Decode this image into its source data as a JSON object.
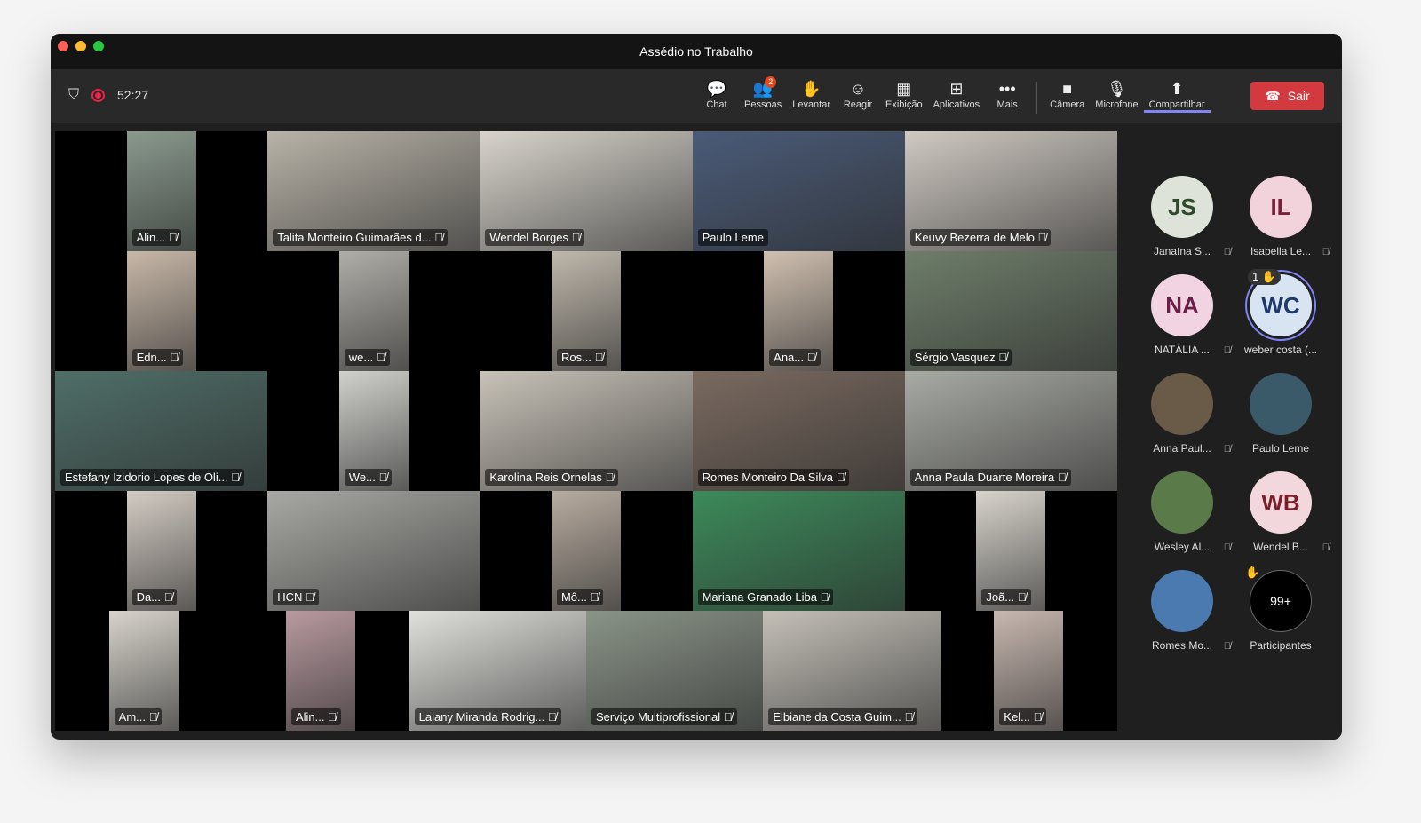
{
  "window": {
    "title": "Assédio no Trabalho"
  },
  "meeting": {
    "timer": "52:27"
  },
  "toolbar": [
    {
      "label": "Chat",
      "icon": "chat-icon",
      "glyph": "💬"
    },
    {
      "label": "Pessoas",
      "icon": "people-icon",
      "glyph": "👥",
      "badge": "2"
    },
    {
      "label": "Levantar",
      "icon": "raise-hand-icon",
      "glyph": "✋"
    },
    {
      "label": "Reagir",
      "icon": "smiley-icon",
      "glyph": "☺"
    },
    {
      "label": "Exibição",
      "icon": "grid-icon",
      "glyph": "▦"
    },
    {
      "label": "Aplicativos",
      "icon": "add-app-icon",
      "glyph": "⊞"
    },
    {
      "label": "Mais",
      "icon": "more-icon",
      "glyph": "•••"
    }
  ],
  "devices": [
    {
      "label": "Câmera",
      "icon": "camera-icon",
      "glyph": "■"
    },
    {
      "label": "Microfone",
      "icon": "mic-off-icon",
      "glyph": "🎙"
    },
    {
      "label": "Compartilhar",
      "icon": "share-icon",
      "glyph": "⬆"
    }
  ],
  "leave": {
    "label": "Sair"
  },
  "grid": [
    [
      {
        "n": "Alin...",
        "narrow": true,
        "c": "#8a9a8e"
      },
      {
        "n": "Talita Monteiro Guimarães d...",
        "c": "#b8b3a8"
      },
      {
        "n": "Wendel Borges",
        "c": "#d8d4cc"
      },
      {
        "n": "Paulo Leme",
        "c": "#4a5b78",
        "nomute": true
      },
      {
        "n": "Keuvy Bezerra de Melo",
        "c": "#cfc9c2"
      }
    ],
    [
      {
        "n": "Edn...",
        "narrow": true,
        "c": "#c8b8a8"
      },
      {
        "n": "we...",
        "narrow": true,
        "c": "#b0aea8"
      },
      {
        "n": "Ros...",
        "narrow": true,
        "c": "#c0b8ac"
      },
      {
        "n": "Ana...",
        "narrow": true,
        "c": "#d0c0b0"
      },
      {
        "n": "Sérgio Vasquez",
        "c": "#6e7d6a"
      }
    ],
    [
      {
        "n": "Estefany Izidorio Lopes de Oli...",
        "c": "#4f6e68"
      },
      {
        "n": "We...",
        "narrow": true,
        "c": "#d0d0cc"
      },
      {
        "n": "Karolina Reis Ornelas",
        "c": "#c8c2b8"
      },
      {
        "n": "Romes Monteiro Da Silva",
        "c": "#7a6a60"
      },
      {
        "n": "Anna Paula Duarte Moreira",
        "c": "#a8aaa4"
      }
    ],
    [
      {
        "n": "Da...",
        "narrow": true,
        "c": "#d4ccc4"
      },
      {
        "n": "HCN",
        "c": "#a8a8a4"
      },
      {
        "n": "Mô...",
        "narrow": true,
        "c": "#b8aca0"
      },
      {
        "n": "Mariana Granado Liba",
        "c": "#3c8a5a"
      },
      {
        "n": "Joã...",
        "narrow": true,
        "c": "#d8d4cc"
      }
    ],
    [
      {
        "n": "Am...",
        "narrow": true,
        "c": "#d8d4cc"
      },
      {
        "n": "Alin...",
        "narrow": true,
        "c": "#b89aa0"
      },
      {
        "n": "Laiany Miranda Rodrig...",
        "c": "#e0e0dc"
      },
      {
        "n": "Serviço Multiprofissional",
        "c": "#8a9488"
      },
      {
        "n": "Elbiane da Costa Guim...",
        "c": "#c4c0b8"
      },
      {
        "n": "Kel...",
        "narrow": true,
        "c": "#c8b8b0"
      }
    ]
  ],
  "participants": [
    {
      "name": "Janaína S...",
      "initials": "JS",
      "bg": "#dde3d8",
      "fg": "#2f4a2a",
      "muted": true
    },
    {
      "name": "Isabella Le...",
      "initials": "IL",
      "bg": "#f2d3dc",
      "fg": "#7a1f3a",
      "muted": true
    },
    {
      "name": "NATÁLIA ...",
      "initials": "NA",
      "bg": "#f2d3e2",
      "fg": "#6a1f48",
      "muted": true
    },
    {
      "name": "weber costa (...",
      "initials": "WC",
      "bg": "#d8e4f2",
      "fg": "#1f3a6a",
      "muted": false,
      "hand": "1 ✋"
    },
    {
      "name": "Anna Paul...",
      "initials": "",
      "bg": "#6a5a48",
      "fg": "#fff",
      "muted": true
    },
    {
      "name": "Paulo Leme",
      "initials": "",
      "bg": "#3a5a6a",
      "fg": "#fff",
      "muted": false
    },
    {
      "name": "Wesley Al...",
      "initials": "",
      "bg": "#5a7a4a",
      "fg": "#fff",
      "muted": true
    },
    {
      "name": "Wendel B...",
      "initials": "WB",
      "bg": "#f2d8dc",
      "fg": "#7a1f2a",
      "muted": true
    },
    {
      "name": "Romes Mo...",
      "initials": "",
      "bg": "#4a7ab0",
      "fg": "#fff",
      "muted": true
    },
    {
      "name": "Participantes",
      "initials": "99+",
      "bg": "#000",
      "fg": "#fff",
      "muted": false,
      "hand": "✋"
    }
  ]
}
